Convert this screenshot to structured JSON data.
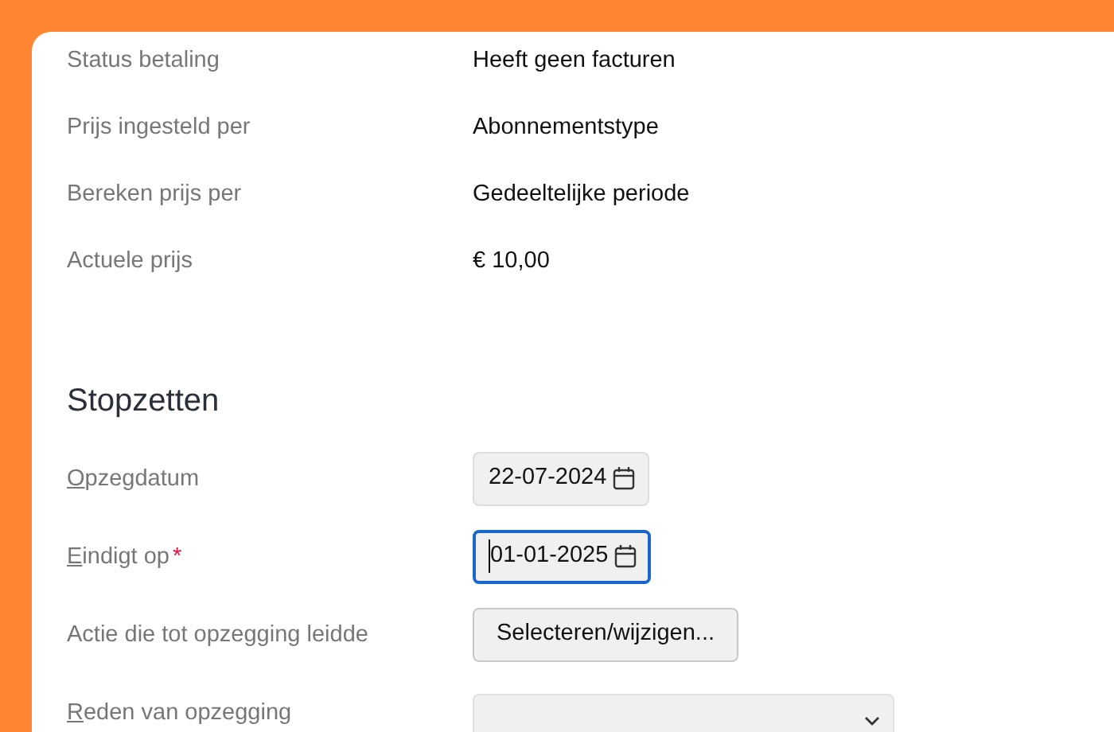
{
  "details": [
    {
      "label": "Status betaling",
      "value": "Heeft geen facturen"
    },
    {
      "label": "Prijs ingesteld per",
      "value": "Abonnementstype"
    },
    {
      "label": "Bereken prijs per",
      "value": "Gedeeltelijke periode"
    },
    {
      "label": "Actuele prijs",
      "value": "€ 10,00"
    }
  ],
  "section": {
    "title": "Stopzetten",
    "fields": [
      {
        "kind": "date",
        "label": "Opzegdatum",
        "access_key": true,
        "required": false,
        "value": "22-07-2024",
        "focused": false
      },
      {
        "kind": "date",
        "label": "Eindigt op",
        "access_key": true,
        "required": true,
        "required_mark": "*",
        "value": "01-01-2025",
        "focused": true
      },
      {
        "kind": "button",
        "label": "Actie die tot opzegging leidde",
        "access_key": false,
        "required": false,
        "value": "Selecteren/wijzigen..."
      },
      {
        "kind": "select",
        "label": "Reden van opzegging",
        "access_key": true,
        "required": false
      }
    ]
  }
}
